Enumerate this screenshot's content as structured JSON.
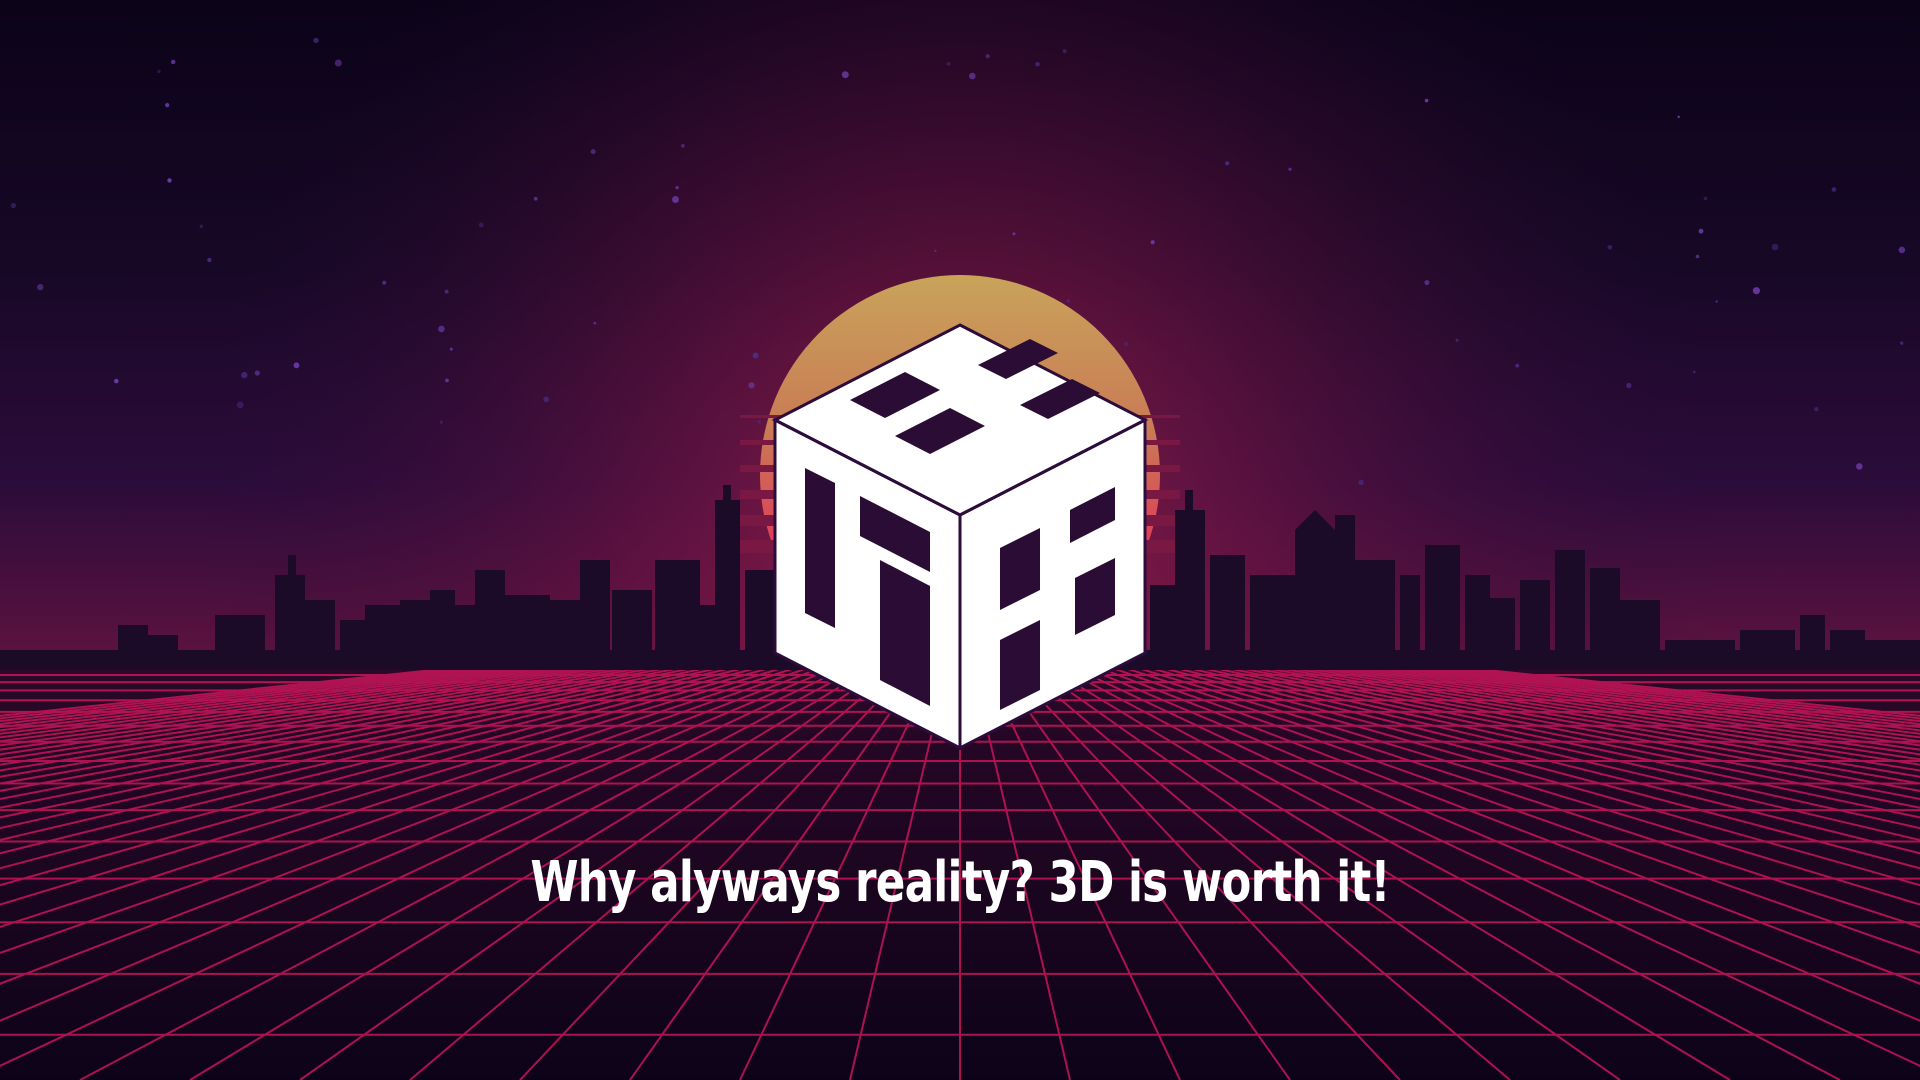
{
  "logo": {
    "letters": "CUBERS",
    "color": "#ffffff"
  },
  "tagline": "Why alyways reality? 3D is worth it!",
  "colors": {
    "sky_top": "#0b0318",
    "sky_mid": "#2c0c3a",
    "horizon_glow": "#8a1a45",
    "sun_top": "#c9a657",
    "sun_bottom": "#e0305a",
    "skyline": "#1a0a26",
    "grid_line": "#c8155a",
    "text": "#ffffff"
  }
}
